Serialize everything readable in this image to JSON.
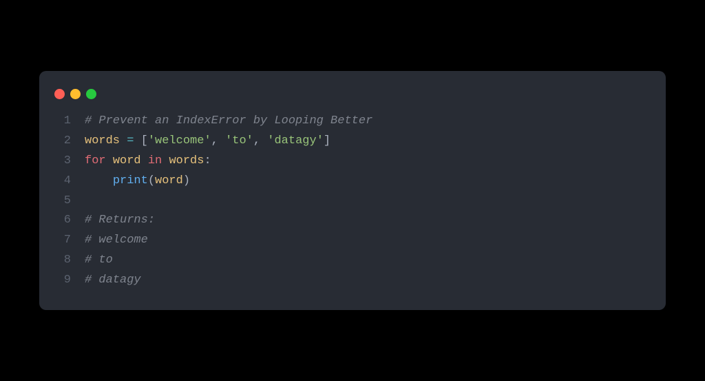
{
  "traffic_lights": [
    "red",
    "yellow",
    "green"
  ],
  "code": {
    "lines": [
      {
        "num": "1",
        "tokens": [
          {
            "cls": "comment",
            "text": "# Prevent an IndexError by Looping Better"
          }
        ]
      },
      {
        "num": "2",
        "tokens": [
          {
            "cls": "ident",
            "text": "words"
          },
          {
            "cls": "plain",
            "text": " "
          },
          {
            "cls": "operator",
            "text": "="
          },
          {
            "cls": "plain",
            "text": " "
          },
          {
            "cls": "bracket",
            "text": "["
          },
          {
            "cls": "string",
            "text": "'welcome'"
          },
          {
            "cls": "punct",
            "text": ", "
          },
          {
            "cls": "string",
            "text": "'to'"
          },
          {
            "cls": "punct",
            "text": ", "
          },
          {
            "cls": "string",
            "text": "'datagy'"
          },
          {
            "cls": "bracket",
            "text": "]"
          }
        ]
      },
      {
        "num": "3",
        "tokens": [
          {
            "cls": "keyword-red",
            "text": "for"
          },
          {
            "cls": "plain",
            "text": " "
          },
          {
            "cls": "ident",
            "text": "word"
          },
          {
            "cls": "plain",
            "text": " "
          },
          {
            "cls": "keyword-red",
            "text": "in"
          },
          {
            "cls": "plain",
            "text": " "
          },
          {
            "cls": "ident",
            "text": "words"
          },
          {
            "cls": "punct",
            "text": ":"
          }
        ]
      },
      {
        "num": "4",
        "tokens": [
          {
            "cls": "plain",
            "text": "    "
          },
          {
            "cls": "function",
            "text": "print"
          },
          {
            "cls": "bracket",
            "text": "("
          },
          {
            "cls": "ident",
            "text": "word"
          },
          {
            "cls": "bracket",
            "text": ")"
          }
        ]
      },
      {
        "num": "5",
        "tokens": []
      },
      {
        "num": "6",
        "tokens": [
          {
            "cls": "comment",
            "text": "# Returns:"
          }
        ]
      },
      {
        "num": "7",
        "tokens": [
          {
            "cls": "comment",
            "text": "# welcome"
          }
        ]
      },
      {
        "num": "8",
        "tokens": [
          {
            "cls": "comment",
            "text": "# to"
          }
        ]
      },
      {
        "num": "9",
        "tokens": [
          {
            "cls": "comment",
            "text": "# datagy"
          }
        ]
      }
    ]
  }
}
